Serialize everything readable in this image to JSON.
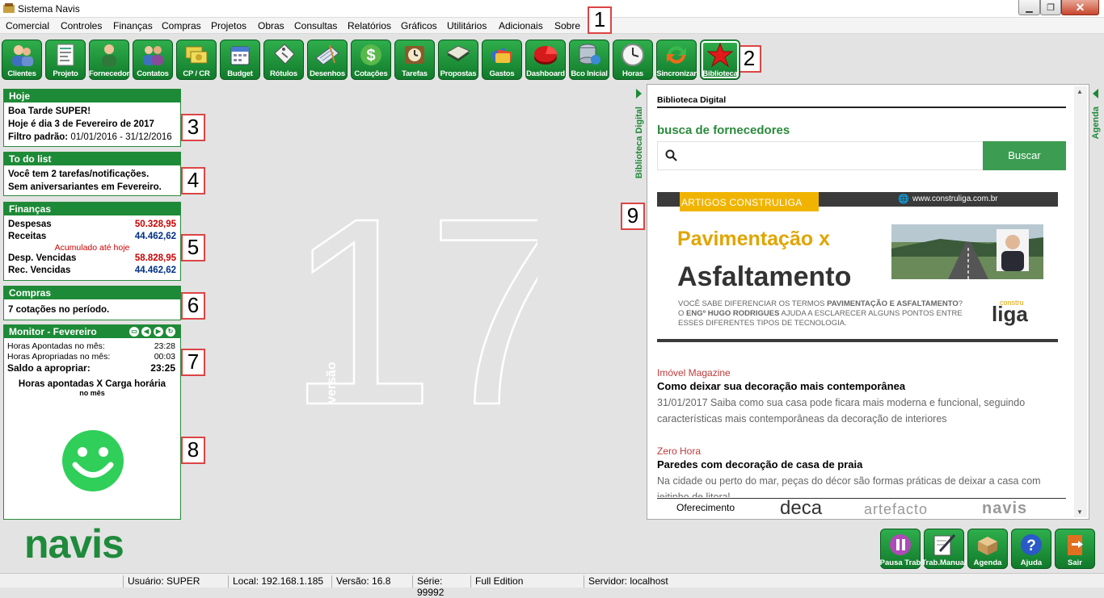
{
  "window": {
    "title": "Sistema Navis"
  },
  "menu": [
    "Comercial",
    "Controles",
    "Finanças",
    "Compras",
    "Projetos",
    "Obras",
    "Consultas",
    "Relatórios",
    "Gráficos",
    "Utilitários",
    "Adicionais",
    "Sobre"
  ],
  "toolbar": [
    "Clientes",
    "Projeto",
    "Fornecedor",
    "Contatos",
    "CP / CR",
    "Budget",
    "Rótulos",
    "Desenhos",
    "Cotações",
    "Tarefas",
    "Propostas",
    "Gastos",
    "Dashboard",
    "Bco Inicial",
    "Horas",
    "Sincronizar",
    "Biblioteca"
  ],
  "markers": [
    "1",
    "2",
    "3",
    "4",
    "5",
    "6",
    "7",
    "8",
    "9"
  ],
  "hoje": {
    "title": "Hoje",
    "greeting": "Boa Tarde SUPER!",
    "date": "Hoje é dia 3 de Fevereiro de 2017",
    "filter_label": "Filtro padrão:",
    "filter_value": "01/01/2016 - 31/12/2016"
  },
  "todo": {
    "title": "To do list",
    "line1": "Você tem 2 tarefas/notificações.",
    "line2": "Sem aniversariantes em Fevereiro."
  },
  "financas": {
    "title": "Finanças",
    "despesas_label": "Despesas",
    "despesas": "50.328,95",
    "receitas_label": "Receitas",
    "receitas": "44.462,62",
    "acumulado": "Acumulado até hoje",
    "desp_venc_label": "Desp. Vencidas",
    "desp_venc": "58.828,95",
    "rec_venc_label": "Rec. Vencidas",
    "rec_venc": "44.462,62",
    "colors": {
      "expense": "#cc0000",
      "income": "#003087"
    }
  },
  "compras": {
    "title": "Compras",
    "text": "7 cotações no período."
  },
  "monitor": {
    "title": "Monitor - Fevereiro",
    "apontadas_label": "Horas Apontadas no mês:",
    "apontadas": "23:28",
    "apropriadas_label": "Horas Apropriadas no mês:",
    "apropriadas": "00:03",
    "saldo_label": "Saldo a apropriar:",
    "saldo": "23:25",
    "chart_title": "Horas apontadas X Carga horária",
    "chart_sub": "no mês"
  },
  "center": {
    "version_word": "versão",
    "version_number": "17"
  },
  "side_tabs": {
    "left": "Biblioteca Digital",
    "right": "Agenda"
  },
  "biblioteca": {
    "header": "Biblioteca Digital",
    "search_title": "busca de fornecedores",
    "search_button": "Buscar",
    "banner": {
      "tag": "ARTIGOS CONSTRULIGA",
      "url": "www.construliga.com.br",
      "headline1": "Pavimentação x",
      "headline2": "Asfaltamento",
      "body_pre": "VOCÊ SABE DIFERENCIAR OS TERMOS ",
      "body_bold": "PAVIMENTAÇÃO E ASFALTAMENTO",
      "body_post": "?",
      "body2_pre": "O ",
      "body2_bold": "ENGº HUGO RODRIGUES",
      "body2_post": " AJUDA A ESCLARECER ALGUNS PONTOS ENTRE",
      "body3": "ESSES DIFERENTES TIPOS DE TECNOLOGIA.",
      "logo_small": "constru",
      "logo_big": "liga"
    },
    "news": [
      {
        "source": "Imóvel Magazine",
        "title": "Como deixar sua decoração mais contemporânea",
        "text": "31/01/2017 Saiba como sua casa pode ficara mais moderna e funcional, seguindo características mais contemporâneas da decoração de interiores"
      },
      {
        "source": "Zero Hora",
        "title": "Paredes com decoração de casa de praia",
        "text": "Na cidade ou perto do mar, peças do décor são formas práticas de deixar a casa com jeitinho de litoral"
      }
    ],
    "sponsor_label": "Oferecimento",
    "sponsors": [
      "deca",
      "artefacto",
      "navis"
    ]
  },
  "brand": "navis",
  "bottom_buttons": [
    "Pausa Trab",
    "Trab.Manual",
    "Agenda",
    "Ajuda",
    "Sair"
  ],
  "status": {
    "usuario": "Usuário: SUPER",
    "local": "Local: 192.168.1.185",
    "versao": "Versão: 16.8",
    "serie": "Série: 99992",
    "edition": "Full Edition",
    "servidor": "Servidor: localhost"
  }
}
